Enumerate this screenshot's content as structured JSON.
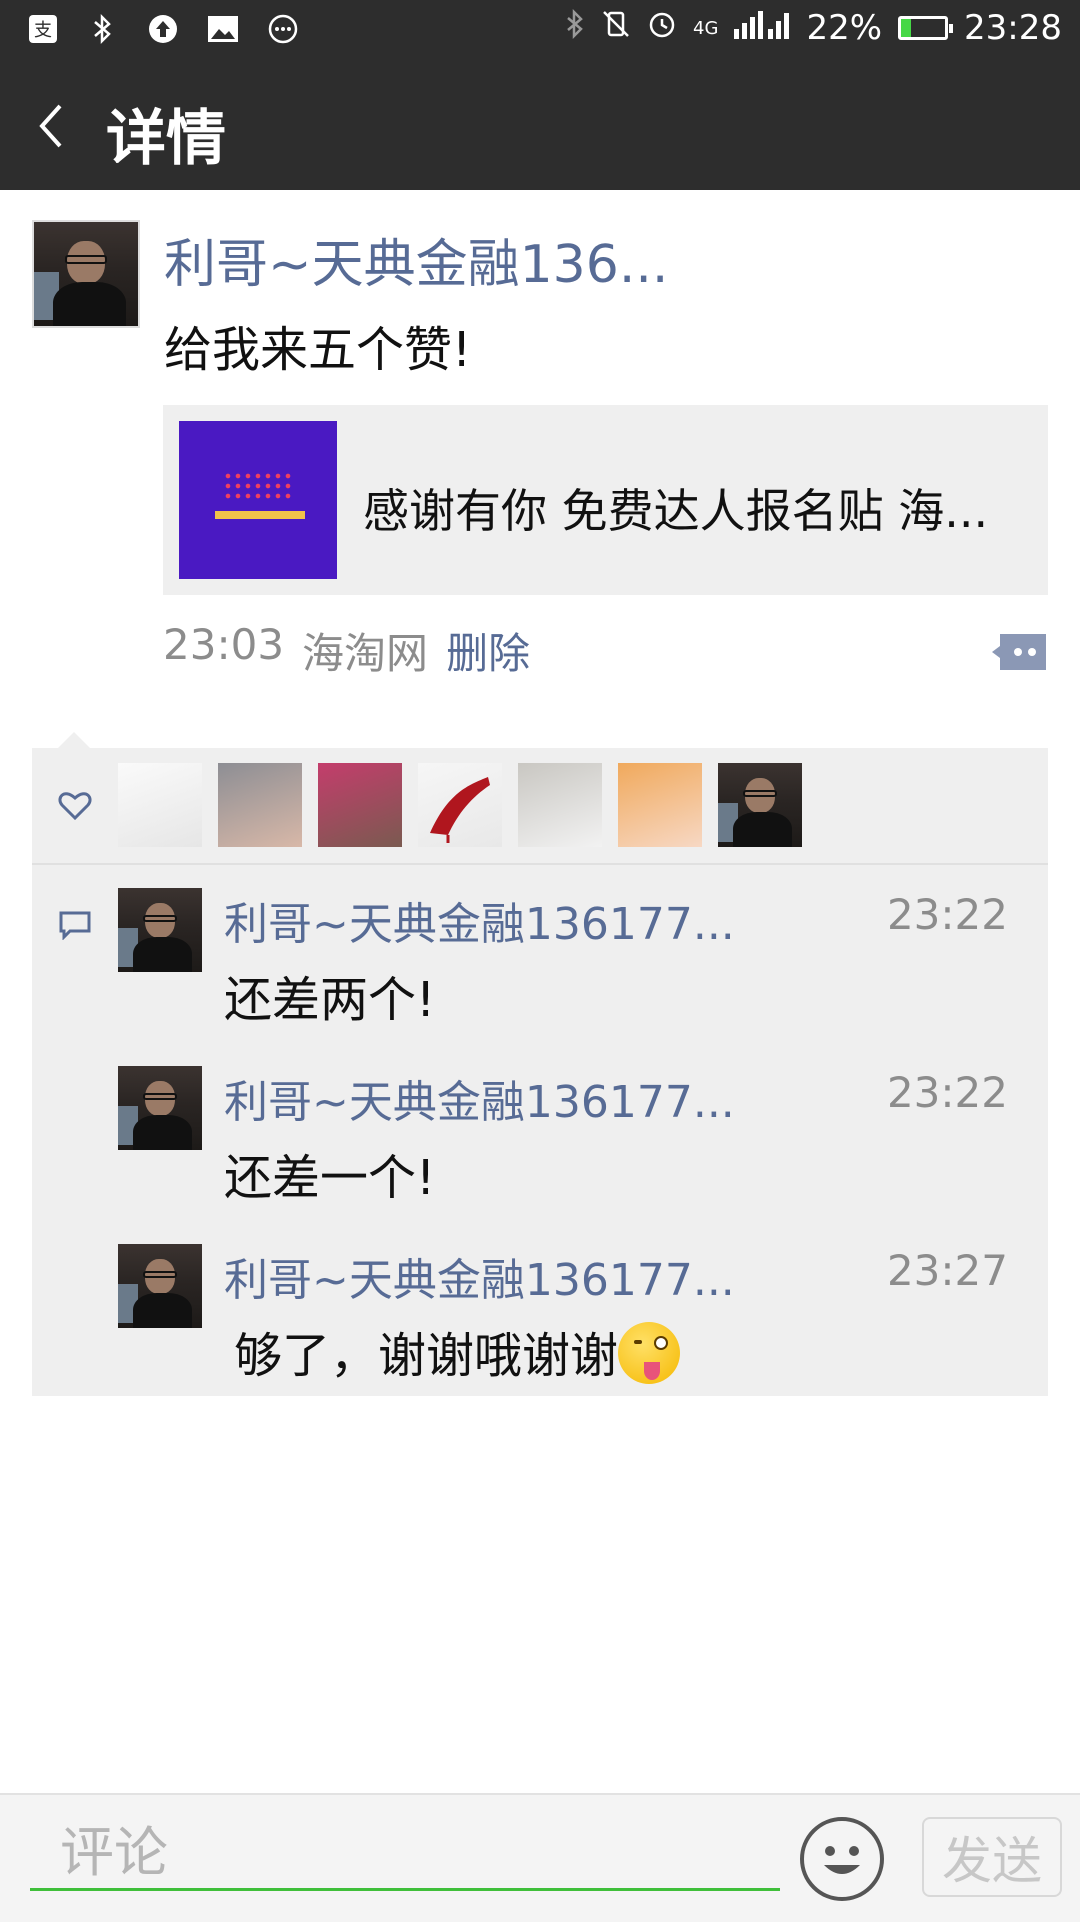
{
  "status_bar": {
    "network": "4G",
    "battery_percent": "22%",
    "time": "23:28",
    "battery_level": 0.22
  },
  "nav": {
    "title": "详情"
  },
  "post": {
    "author": "利哥~天典金融136...",
    "text": "给我来五个赞!",
    "link": {
      "title": "感谢有你 免费达人报名贴 海..."
    },
    "time": "23:03",
    "source": "海淘网",
    "delete_label": "删除"
  },
  "likes": {
    "avatars": [
      "liker-avatar-1",
      "liker-avatar-2",
      "liker-avatar-3",
      "liker-avatar-4",
      "liker-avatar-5",
      "liker-avatar-6",
      "liker-avatar-7"
    ]
  },
  "comments": [
    {
      "name": "利哥~天典金融136177...",
      "time": "23:22",
      "text": "还差两个!"
    },
    {
      "name": "利哥~天典金融136177...",
      "time": "23:22",
      "text": "还差一个!"
    },
    {
      "name": "利哥~天典金融136177...",
      "time": "23:27",
      "text": "够了，谢谢哦谢谢",
      "emoji": "wink-tongue-emoji"
    }
  ],
  "bottom_bar": {
    "placeholder": "评论",
    "send_label": "发送"
  },
  "colors": {
    "bar_bg": "#2d2d2d",
    "name_blue": "#576b95",
    "input_underline": "#3fbf3a"
  }
}
